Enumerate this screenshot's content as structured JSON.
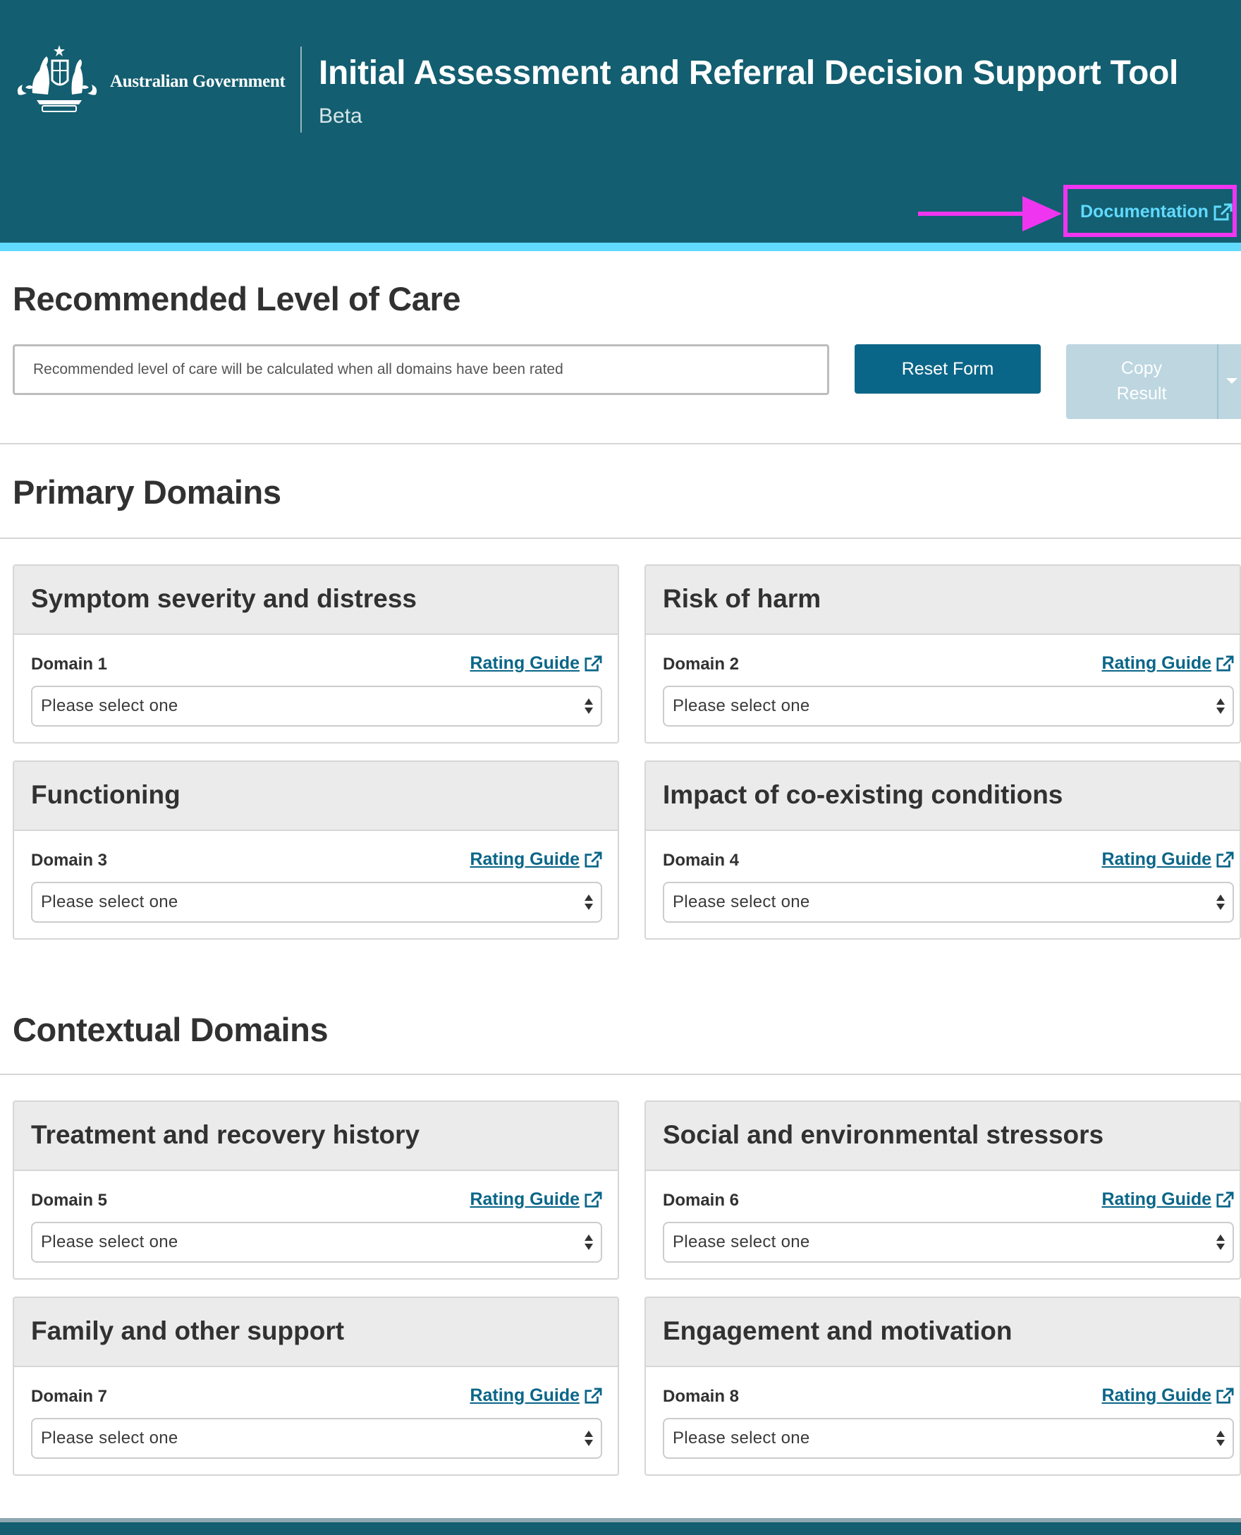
{
  "header": {
    "government_name": "Australian Government",
    "title": "Initial Assessment and Referral Decision Support Tool",
    "subtitle": "Beta",
    "documentation_label": "Documentation",
    "crest_icon": "australian-coat-of-arms-icon",
    "external_link_icon": "external-link-icon",
    "colors": {
      "background": "#135e70",
      "accent_strip": "#61daff",
      "link": "#61daff",
      "annotation": "#f035f0"
    }
  },
  "recommended": {
    "heading": "Recommended Level of Care",
    "placeholder": "Recommended level of care will be calculated when all domains have been rated",
    "reset_label": "Reset Form",
    "copy_label_line1": "Copy",
    "copy_label_line2": "Result"
  },
  "primary": {
    "heading": "Primary Domains",
    "cards": [
      {
        "title": "Symptom severity and distress",
        "domain": "Domain 1",
        "guide": "Rating Guide",
        "select": "Please select one"
      },
      {
        "title": "Risk of harm",
        "domain": "Domain 2",
        "guide": "Rating Guide",
        "select": "Please select one"
      },
      {
        "title": "Functioning",
        "domain": "Domain 3",
        "guide": "Rating Guide",
        "select": "Please select one"
      },
      {
        "title": "Impact of co-existing conditions",
        "domain": "Domain 4",
        "guide": "Rating Guide",
        "select": "Please select one"
      }
    ]
  },
  "contextual": {
    "heading": "Contextual Domains",
    "cards": [
      {
        "title": "Treatment and recovery history",
        "domain": "Domain 5",
        "guide": "Rating Guide",
        "select": "Please select one"
      },
      {
        "title": "Social and environmental stressors",
        "domain": "Domain 6",
        "guide": "Rating Guide",
        "select": "Please select one"
      },
      {
        "title": "Family and other support",
        "domain": "Domain 7",
        "guide": "Rating Guide",
        "select": "Please select one"
      },
      {
        "title": "Engagement and motivation",
        "domain": "Domain 8",
        "guide": "Rating Guide",
        "select": "Please select one"
      }
    ]
  }
}
